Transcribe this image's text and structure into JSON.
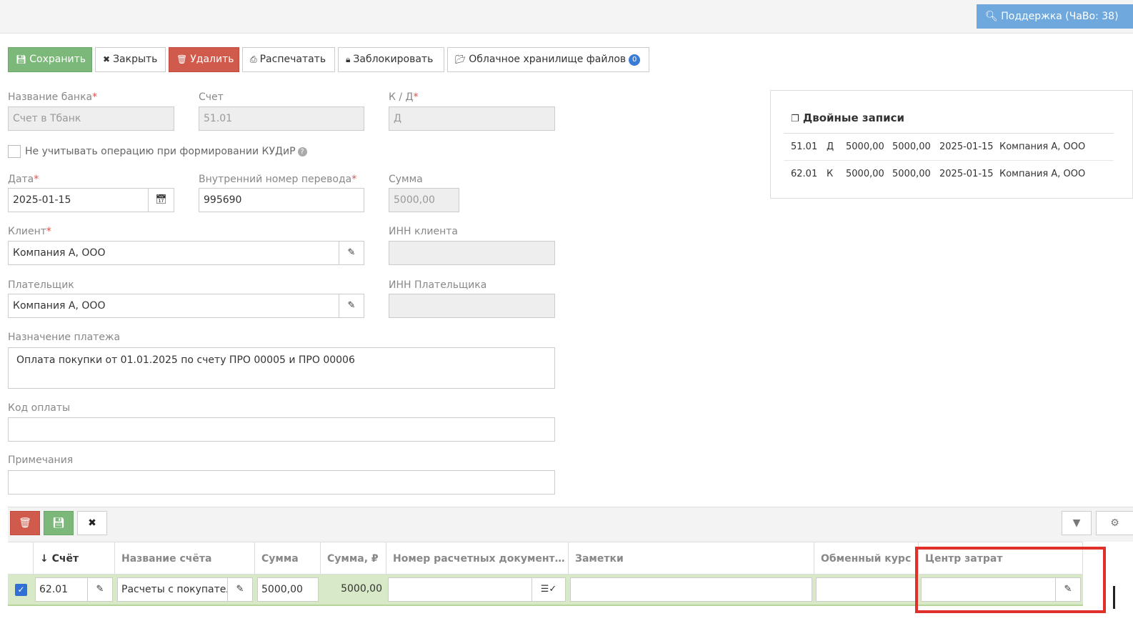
{
  "topbar": {
    "support_label": "Поддержка (ЧаВо: 38)"
  },
  "toolbar": {
    "save": "Сохранить",
    "close": "Закрыть",
    "delete": "Удалить",
    "print": "Распечатать",
    "lock": "Заблокировать",
    "cloud": "Облачное хранилище файлов",
    "cloud_count": "0"
  },
  "form": {
    "bank_name": {
      "label": "Название банка",
      "value": "Счет в Тбанк"
    },
    "account": {
      "label": "Счет",
      "value": "51.01"
    },
    "kd": {
      "label": "К / Д",
      "value": "Д"
    },
    "exclude_kudir": {
      "label": "Не учитывать операцию при формировании КУДиР",
      "checked": false
    },
    "date": {
      "label": "Дата",
      "value": "2025-01-15"
    },
    "transfer_no": {
      "label": "Внутренний номер перевода",
      "value": "995690"
    },
    "amount": {
      "label": "Сумма",
      "value": "5000,00"
    },
    "client": {
      "label": "Клиент",
      "value": "Компания А, ООО"
    },
    "client_inn": {
      "label": "ИНН клиента",
      "value": ""
    },
    "payer": {
      "label": "Плательщик",
      "value": "Компания А, ООО"
    },
    "payer_inn": {
      "label": "ИНН Плательщика",
      "value": ""
    },
    "purpose": {
      "label": "Назначение платежа",
      "value": "Оплата покупки от 01.01.2025 по счету ПРО 00005 и ПРО 00006"
    },
    "payment_code": {
      "label": "Код оплаты",
      "value": ""
    },
    "notes": {
      "label": "Примечания",
      "value": ""
    }
  },
  "double_entries": {
    "title": "Двойные записи",
    "rows": [
      {
        "account": "51.01",
        "side": "Д",
        "amount": "5000,00",
        "amount2": "5000,00",
        "date": "2025-01-15",
        "party": "Компания А, ООО"
      },
      {
        "account": "62.01",
        "side": "К",
        "amount": "5000,00",
        "amount2": "5000,00",
        "date": "2025-01-15",
        "party": "Компания А, ООО"
      }
    ]
  },
  "grid": {
    "columns": {
      "account": "Счёт",
      "account_name": "Название счёта",
      "sum": "Сумма",
      "sum_rub": "Сумма, ₽",
      "docs": "Номер расчетных документ…",
      "notes": "Заметки",
      "rate": "Обменный курс",
      "cost_center": "Центр затрат"
    },
    "row": {
      "selected": true,
      "account": "62.01",
      "account_name": "Расчеты с покупателями",
      "sum": "5000,00",
      "sum_rub": "5000,00",
      "docs": "",
      "notes": "",
      "rate": "",
      "cost_center": ""
    }
  },
  "colors": {
    "success": "#7cb87a",
    "danger": "#d05a4b",
    "info": "#6fa8dc",
    "highlight": "#e0302a"
  }
}
